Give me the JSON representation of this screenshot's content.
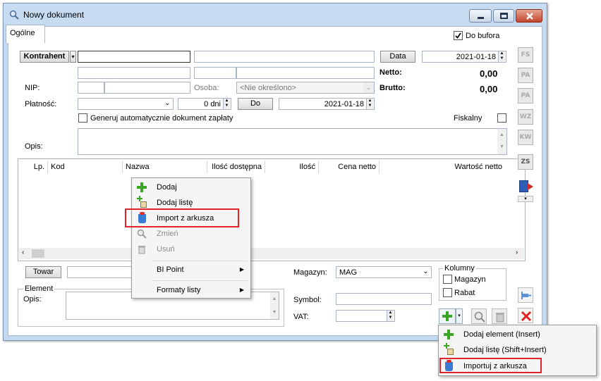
{
  "window": {
    "title": "Nowy dokument"
  },
  "tabs": {
    "ogolne": "Ogólne"
  },
  "header": {
    "do_bufora": "Do bufora",
    "kontrahent": "Kontrahent",
    "data_btn": "Data",
    "data_value": "2021-01-18",
    "netto_label": "Netto:",
    "netto_value": "0,00",
    "brutto_label": "Brutto:",
    "brutto_value": "0,00",
    "nip_label": "NIP:",
    "osoba_label": "Osoba:",
    "osoba_value": "<Nie określono>",
    "platnosc_label": "Płatność:",
    "dni_value": "0 dni",
    "do_btn": "Do",
    "do_value": "2021-01-18",
    "generuj": "Generuj automatycznie dokument zapłaty",
    "fiskalny": "Fiskalny",
    "opis_label": "Opis:"
  },
  "grid": {
    "columns": [
      "Lp.",
      "Kod",
      "Nazwa",
      "Ilość dostępna",
      "Ilość",
      "Cena netto",
      "Wartość netto"
    ]
  },
  "context_menu": {
    "items": [
      "Dodaj",
      "Dodaj listę",
      "Import z arkusza",
      "Zmień",
      "Usuń",
      "BI Point",
      "Formaty listy"
    ]
  },
  "bottom": {
    "towar_btn": "Towar",
    "magazyn_label": "Magazyn:",
    "magazyn_value": "MAG",
    "kolumny": "Kolumny",
    "magazyn_chk": "Magazyn",
    "rabat_chk": "Rabat",
    "element": "Element",
    "opis_label": "Opis:",
    "symbol_label": "Symbol:",
    "vat_label": "VAT:"
  },
  "side_buttons": [
    "FS",
    "PA",
    "PA",
    "WZ",
    "KW",
    "ZS"
  ],
  "add_dropdown": {
    "items": [
      "Dodaj element (Insert)",
      "Dodaj listę (Shift+Insert)",
      "Importuj z arkusza"
    ]
  }
}
